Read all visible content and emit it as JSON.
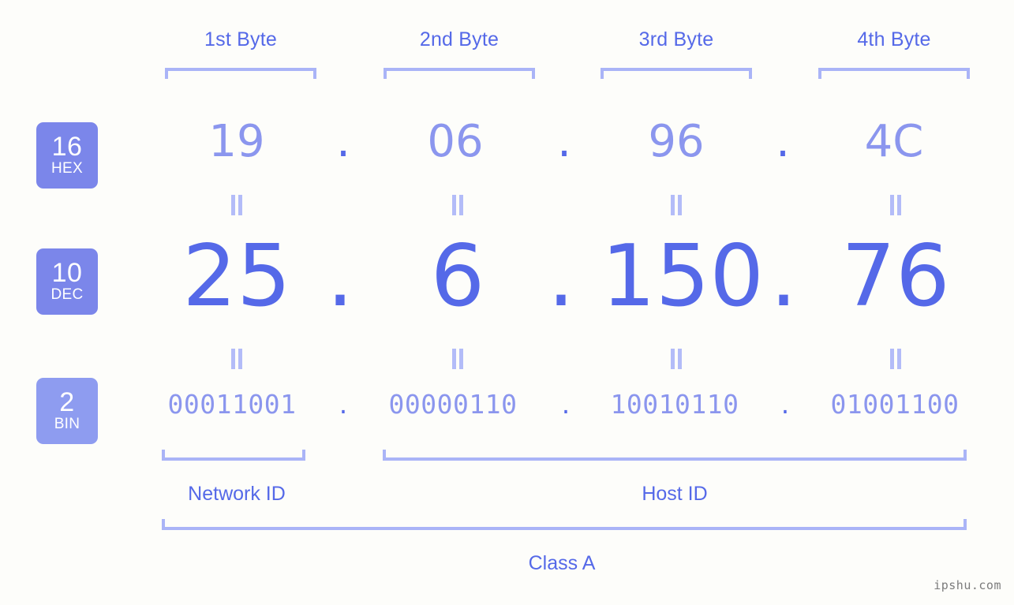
{
  "background_color": "#fdfdfa",
  "accent_color": "#5569e8",
  "accent_light_color": "#8b96ee",
  "bracket_color": "#aab4f7",
  "byte_headers": [
    {
      "label": "1st Byte"
    },
    {
      "label": "2nd Byte"
    },
    {
      "label": "3rd Byte"
    },
    {
      "label": "4th Byte"
    }
  ],
  "rows": [
    {
      "badge": {
        "num": "16",
        "tag": "HEX",
        "color": "#7b86ea"
      },
      "values": [
        "19",
        "06",
        "96",
        "4C"
      ],
      "separator": "."
    },
    {
      "badge": {
        "num": "10",
        "tag": "DEC",
        "color": "#7b86ea"
      },
      "values": [
        "25",
        "6",
        "150",
        "76"
      ],
      "separator": "."
    },
    {
      "badge": {
        "num": "2",
        "tag": "BIN",
        "color": "#8e9cf0"
      },
      "values": [
        "00011001",
        "00000110",
        "10010110",
        "01001100"
      ],
      "separator": "."
    }
  ],
  "equals_symbol": "=",
  "footer": {
    "network_id_label": "Network ID",
    "host_id_label": "Host ID",
    "class_label": "Class A"
  },
  "watermark": "ipshu.com"
}
